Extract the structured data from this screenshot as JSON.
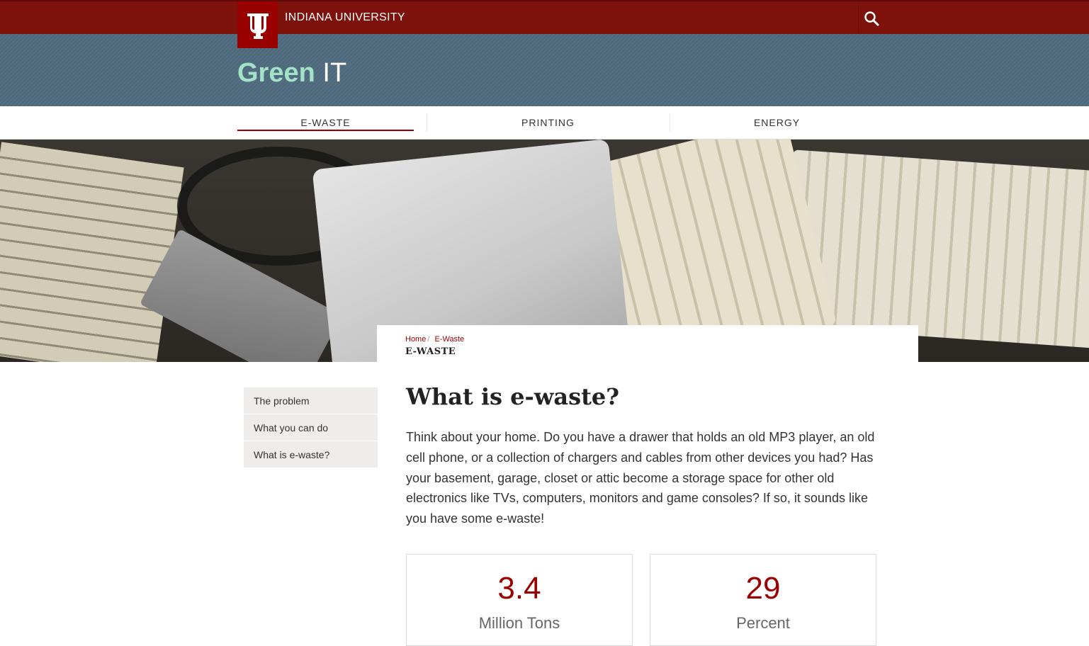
{
  "top_bar": {
    "institution": "INDIANA UNIVERSITY",
    "logo_alt": "IU trident logo"
  },
  "site": {
    "title_accent": "Green",
    "title_rest": "IT"
  },
  "nav": {
    "items": [
      {
        "label": "E-WASTE"
      },
      {
        "label": "PRINTING"
      },
      {
        "label": "ENERGY"
      }
    ],
    "active_index": 0
  },
  "breadcrumb": {
    "items": [
      "Home",
      "E-Waste"
    ],
    "current": "E-WASTE"
  },
  "sidebar": {
    "items": [
      {
        "label": "The problem"
      },
      {
        "label": "What you can do"
      },
      {
        "label": "What is e-waste?"
      }
    ]
  },
  "main": {
    "heading": "What is e-waste?",
    "body": "Think about your home. Do you have a drawer that holds an old MP3 player, an old cell phone, or a collection of chargers and cables from other devices you had? Has your basement, garage, closet or attic become a storage space for other old electronics like TVs, computers, monitors and game consoles? If so, it sounds like you have some e-waste!",
    "stats": [
      {
        "number": "3.4",
        "unit": "Million Tons"
      },
      {
        "number": "29",
        "unit": "Percent"
      }
    ]
  },
  "colors": {
    "iu_crimson": "#990000",
    "banner": "#4e6b7e",
    "green_accent": "#a4e2c8"
  },
  "icons": {
    "search": "search-icon",
    "logo": "iu-trident-icon"
  }
}
